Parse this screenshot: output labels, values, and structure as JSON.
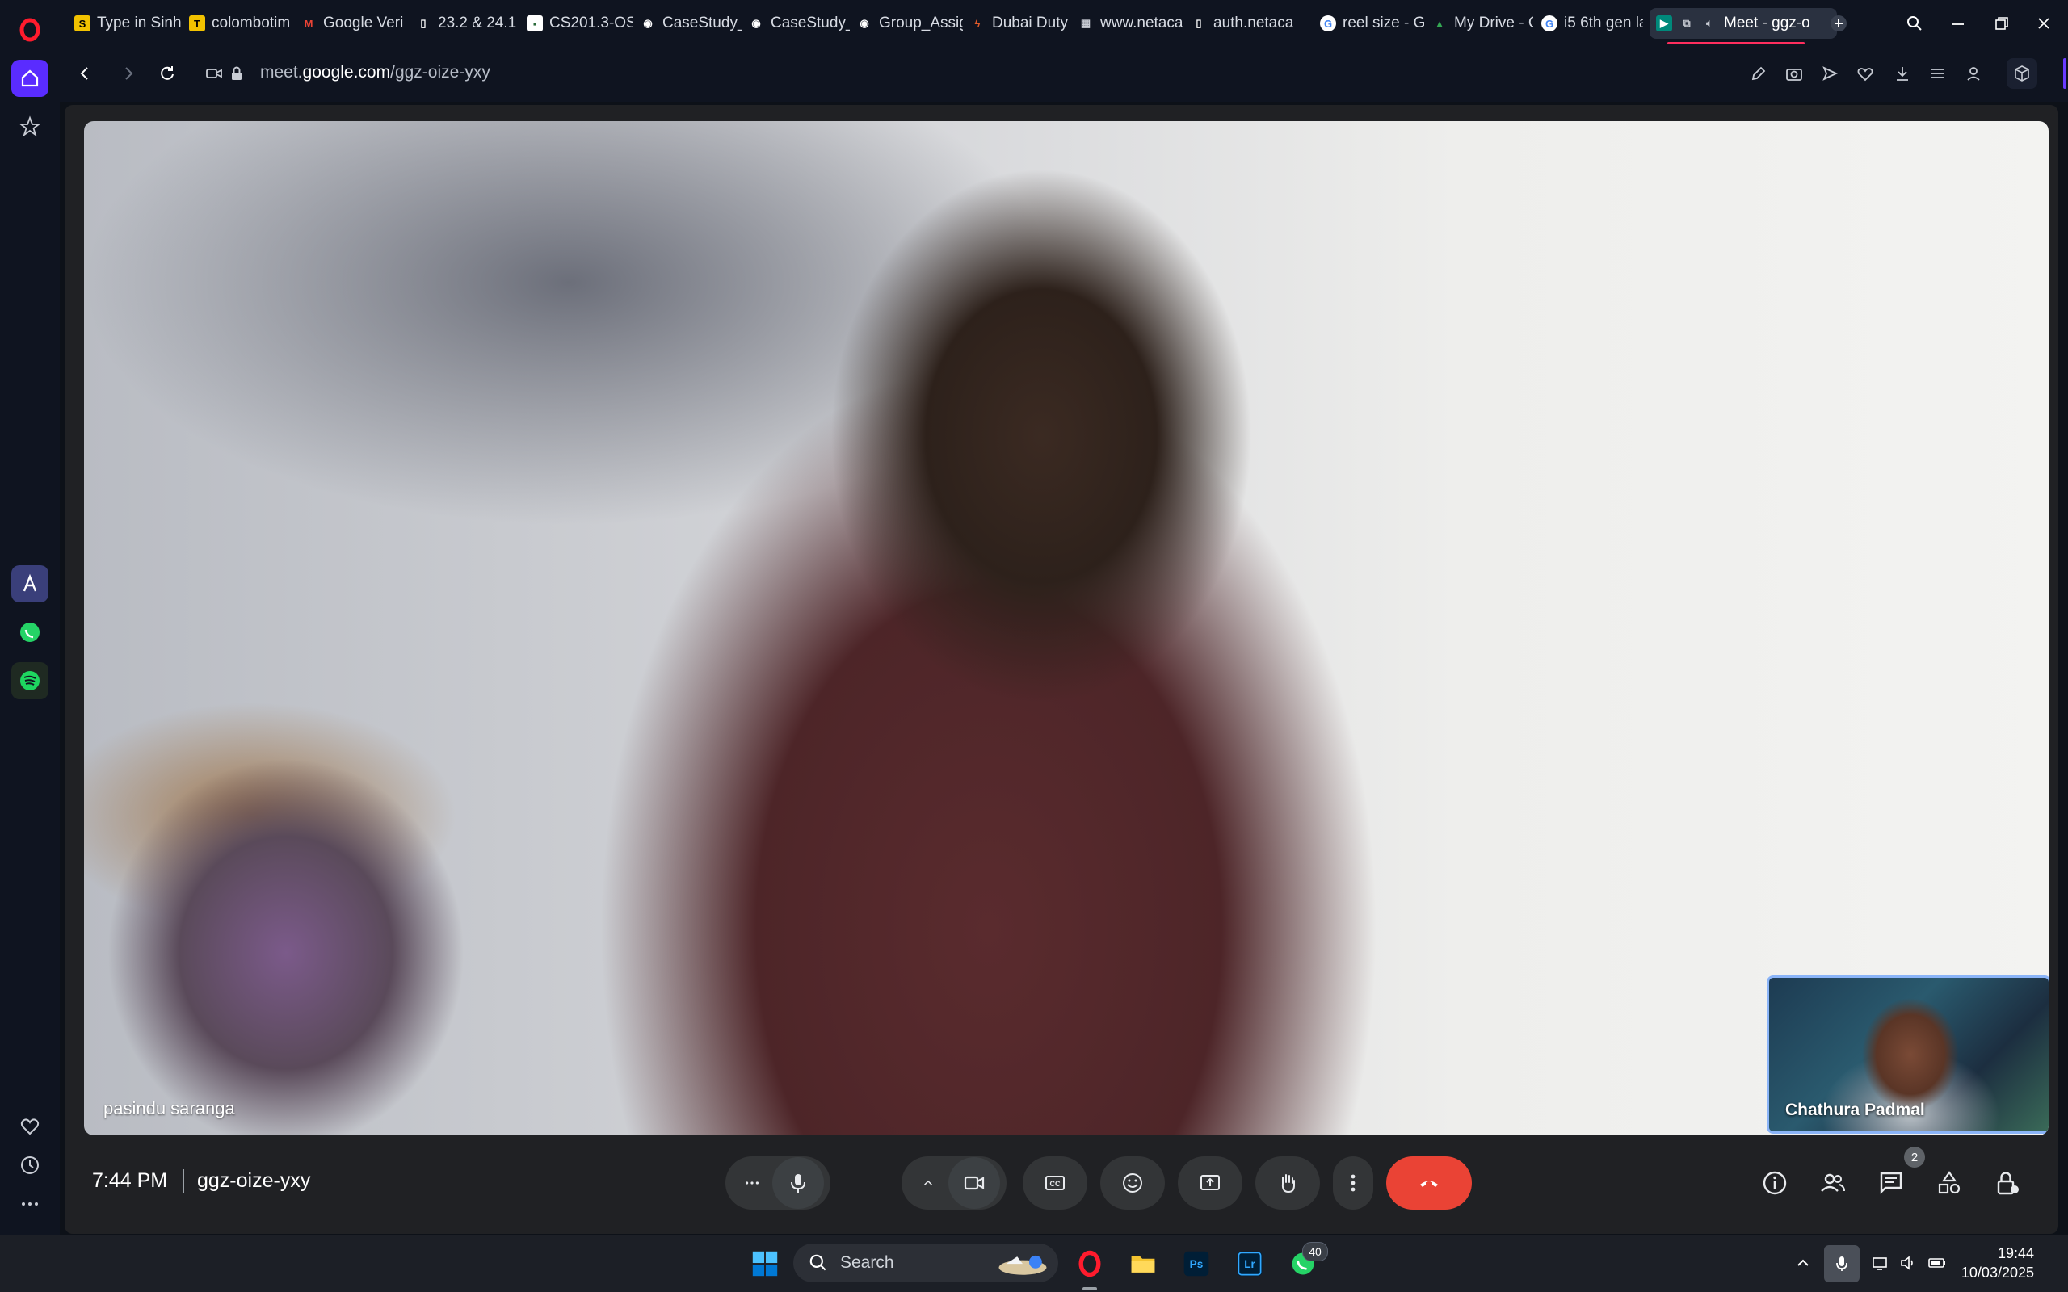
{
  "browser": {
    "tabs": [
      {
        "title": "Type in Sinh",
        "icon": "doc-icon"
      },
      {
        "title": "colombotim",
        "icon": "news-icon"
      },
      {
        "title": "Google Veri",
        "icon": "gmail-icon"
      },
      {
        "title": "23.2 & 24.1",
        "icon": "doc-icon"
      },
      {
        "title": "CS201.3-OS",
        "icon": "site-icon"
      },
      {
        "title": "CaseStudy_",
        "icon": "globe-icon"
      },
      {
        "title": "CaseStudy_",
        "icon": "globe-icon"
      },
      {
        "title": "Group_Assig",
        "icon": "globe-icon"
      },
      {
        "title": "Dubai Duty",
        "icon": "site-icon"
      },
      {
        "title": "www.netaca",
        "icon": "site-icon"
      },
      {
        "title": "auth.netaca",
        "icon": "doc-icon"
      },
      {
        "title": "reel size - G",
        "icon": "google-icon"
      },
      {
        "title": "My Drive - C",
        "icon": "drive-icon"
      },
      {
        "title": "i5 6th gen la",
        "icon": "google-icon"
      },
      {
        "title": "Meet - ggz-o",
        "icon": "meet-icon",
        "active": true
      }
    ],
    "url_prefix": "meet.",
    "url_domain": "google.com",
    "url_path": "/ggz-oize-yxy"
  },
  "meet": {
    "main_participant": "pasindu saranga",
    "self_participant": "Chathura Padmal",
    "time": "7:44 PM",
    "meeting_code": "ggz-oize-yxy",
    "participant_count": "2"
  },
  "taskbar": {
    "search_placeholder": "Search",
    "whatsapp_badge": "40",
    "time": "19:44",
    "date": "10/03/2025"
  },
  "colors": {
    "end_call": "#ea4335",
    "accent": "#8ab4f8",
    "sidebar_active": "#6a3cff"
  }
}
